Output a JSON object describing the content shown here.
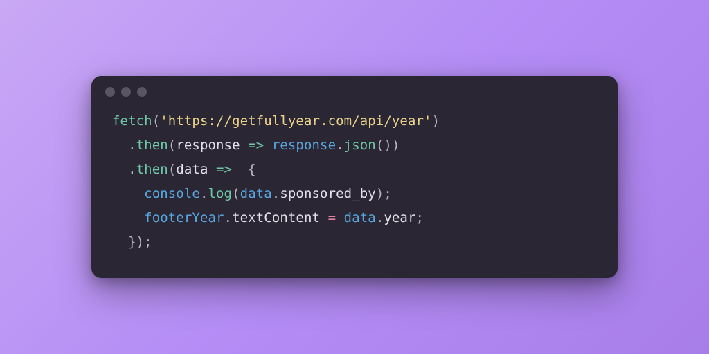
{
  "window": {
    "traffic_light_count": 3
  },
  "code": {
    "tokens": {
      "fn_fetch": "fetch",
      "punc_open_paren": "(",
      "str_url": "'https://getfullyear.com/api/year'",
      "punc_close_paren": ")",
      "punc_dot": ".",
      "fn_then": "then",
      "param_response": "response",
      "arrow": " => ",
      "obj_response": "response",
      "fn_json": "json",
      "empty_parens": "()",
      "param_data": "data",
      "brace_open": " {",
      "obj_console": "console",
      "fn_log": "log",
      "obj_data": "data",
      "prop_sponsored_by": "sponsored_by",
      "punc_semi": ";",
      "obj_footerYear": "footerYear",
      "prop_textContent": "textContent",
      "op_eq": " = ",
      "prop_year": "year",
      "brace_close": "}",
      "close_paren_semi": ");"
    },
    "indent": {
      "one": "  ",
      "two": "    "
    }
  }
}
